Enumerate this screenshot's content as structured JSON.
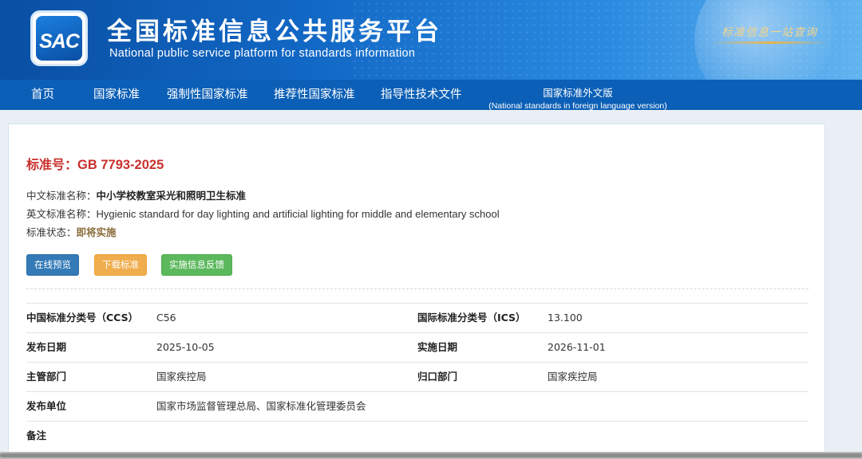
{
  "header": {
    "logo_text": "SAC",
    "title_cn": "全国标准信息公共服务平台",
    "title_en": "National public service platform  for standards information",
    "slogan": "标准信息一站查询"
  },
  "nav": {
    "items": [
      {
        "label": "首页"
      },
      {
        "label": "国家标准"
      },
      {
        "label": "强制性国家标准"
      },
      {
        "label": "推荐性国家标准"
      },
      {
        "label": "指导性技术文件"
      }
    ],
    "foreign": {
      "label": "国家标准外文版",
      "sub_label": "(National standards in foreign language version)"
    }
  },
  "standard": {
    "number_label": "标准号：",
    "number": "GB 7793-2025",
    "cn_name_label": "中文标准名称：",
    "cn_name": "中小学校教室采光和照明卫生标准",
    "en_name_label": "英文标准名称：",
    "en_name": "Hygienic standard for day lighting and artificial lighting for middle and elementary school",
    "status_label": "标准状态：",
    "status": "即将实施"
  },
  "buttons": {
    "preview": "在线预览",
    "download": "下载标准",
    "feedback": "实施信息反馈"
  },
  "details": {
    "rows": [
      {
        "l1": "中国标准分类号（CCS）",
        "v1": "C56",
        "l2": "国际标准分类号（ICS）",
        "v2": "13.100"
      },
      {
        "l1": "发布日期",
        "v1": "2025-10-05",
        "l2": "实施日期",
        "v2": "2026-11-01"
      },
      {
        "l1": "主管部门",
        "v1": "国家疾控局",
        "l2": "归口部门",
        "v2": "国家疾控局"
      },
      {
        "l1": "发布单位",
        "v1": "国家市场监督管理总局、国家标准化管理委员会"
      },
      {
        "l1": "备注",
        "v1": ""
      }
    ]
  },
  "colors": {
    "nav_bg": "#0c5fb6",
    "std_number": "#c9302c",
    "status": "#8a6d3b",
    "btn_preview": "#337ab7",
    "btn_download": "#f0ad4e",
    "btn_feedback": "#5cb85c"
  }
}
